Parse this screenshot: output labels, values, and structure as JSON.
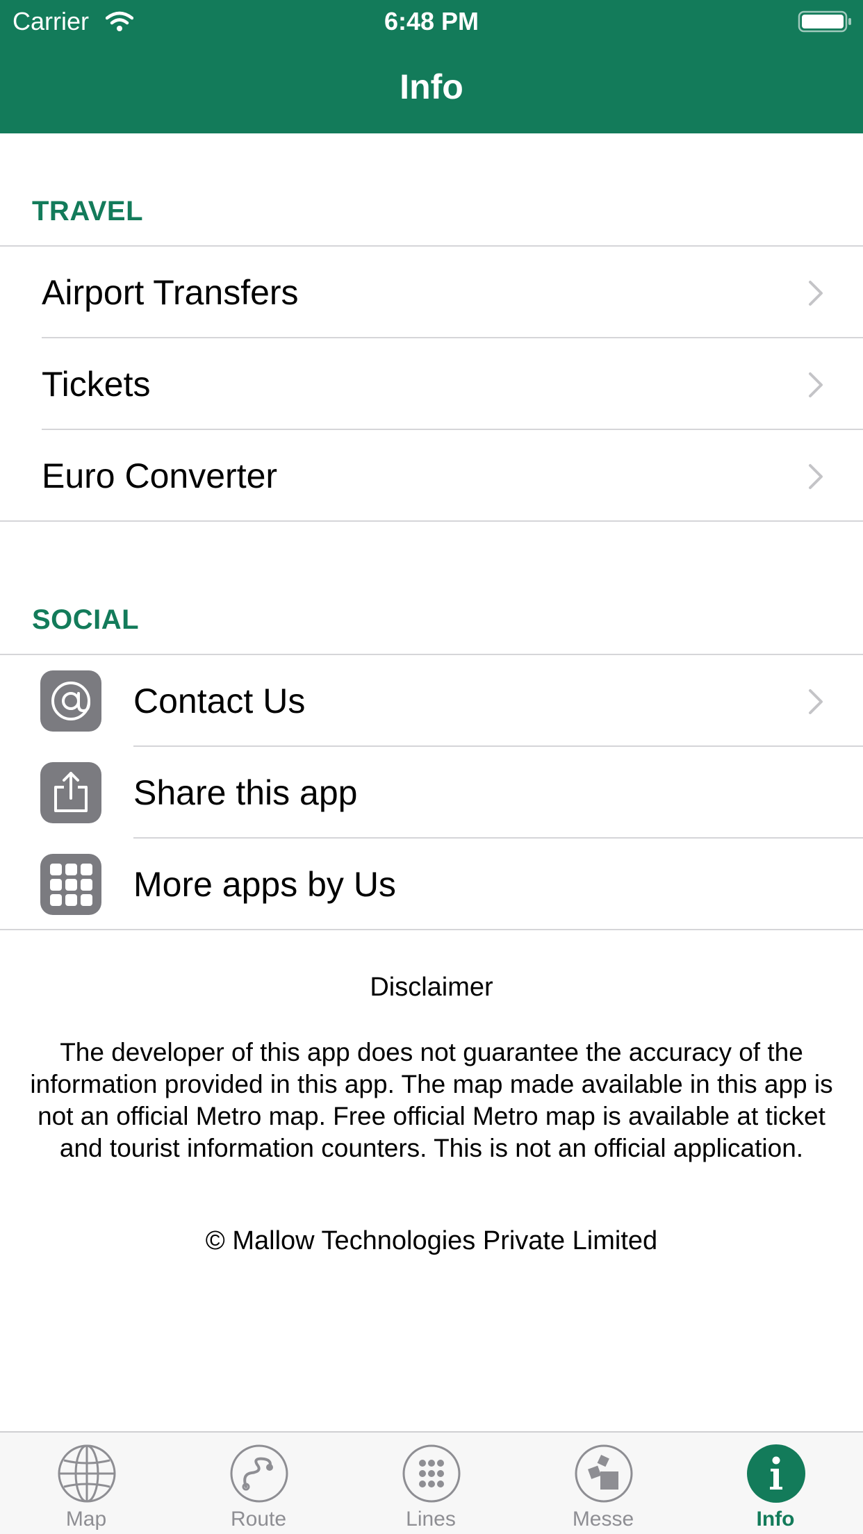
{
  "status_bar": {
    "carrier": "Carrier",
    "time": "6:48 PM"
  },
  "nav": {
    "title": "Info"
  },
  "colors": {
    "brand": "#137b5a",
    "icon_gray": "#7b7b80",
    "tab_inactive": "#8e8e93"
  },
  "travel": {
    "header": "TRAVEL",
    "items": [
      {
        "label": "Airport Transfers"
      },
      {
        "label": "Tickets"
      },
      {
        "label": "Euro Converter"
      }
    ]
  },
  "social": {
    "header": "SOCIAL",
    "items": [
      {
        "label": "Contact Us",
        "icon": "at-sign-icon"
      },
      {
        "label": "Share this app",
        "icon": "share-icon"
      },
      {
        "label": "More apps by Us",
        "icon": "app-grid-icon"
      }
    ]
  },
  "disclaimer": {
    "title": "Disclaimer",
    "body": "The developer of this app does not guarantee the accuracy of the information provided in this app. The map made available in this app is not an official Metro map. Free official Metro map is available at ticket and tourist information counters. This is not an official application.",
    "copyright": "© Mallow Technologies Private Limited"
  },
  "tabs": [
    {
      "label": "Map",
      "icon": "globe-icon"
    },
    {
      "label": "Route",
      "icon": "route-icon"
    },
    {
      "label": "Lines",
      "icon": "dots-grid-icon"
    },
    {
      "label": "Messe",
      "icon": "messe-icon"
    },
    {
      "label": "Info",
      "icon": "info-icon",
      "active": true
    }
  ]
}
